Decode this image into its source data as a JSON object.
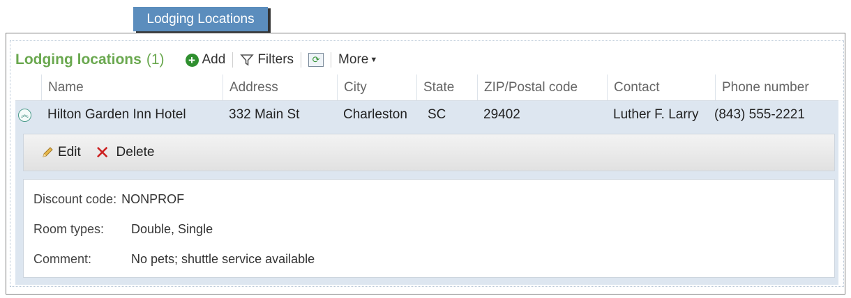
{
  "tab": {
    "label": "Lodging Locations"
  },
  "toolbar": {
    "title": "Lodging locations",
    "count": "(1)",
    "add_label": "Add",
    "filters_label": "Filters",
    "more_label": "More"
  },
  "grid": {
    "columns": [
      "Name",
      "Address",
      "City",
      "State",
      "ZIP/Postal code",
      "Contact",
      "Phone number"
    ],
    "rows": [
      {
        "name": "Hilton Garden Inn Hotel",
        "address": "332 Main St",
        "city": "Charleston",
        "state": "SC",
        "zip": "29402",
        "contact": "Luther F. Larry",
        "phone": "(843) 555-2221"
      }
    ]
  },
  "actions": {
    "edit_label": "Edit",
    "delete_label": "Delete"
  },
  "details": {
    "discount_label": "Discount code:",
    "discount_value": "NONPROF",
    "room_label": "Room types:",
    "room_value": "Double, Single",
    "comment_label": "Comment:",
    "comment_value": "No pets; shuttle service available"
  },
  "colors": {
    "accent_green": "#6aa84f",
    "tab_blue": "#5b8dbd",
    "row_highlight": "#dde6f0",
    "delete_red": "#cc2020"
  },
  "icons": [
    "add-icon",
    "filter-icon",
    "refresh-icon",
    "chevron-down-icon",
    "collapse-icon",
    "pencil-icon",
    "delete-x-icon"
  ]
}
